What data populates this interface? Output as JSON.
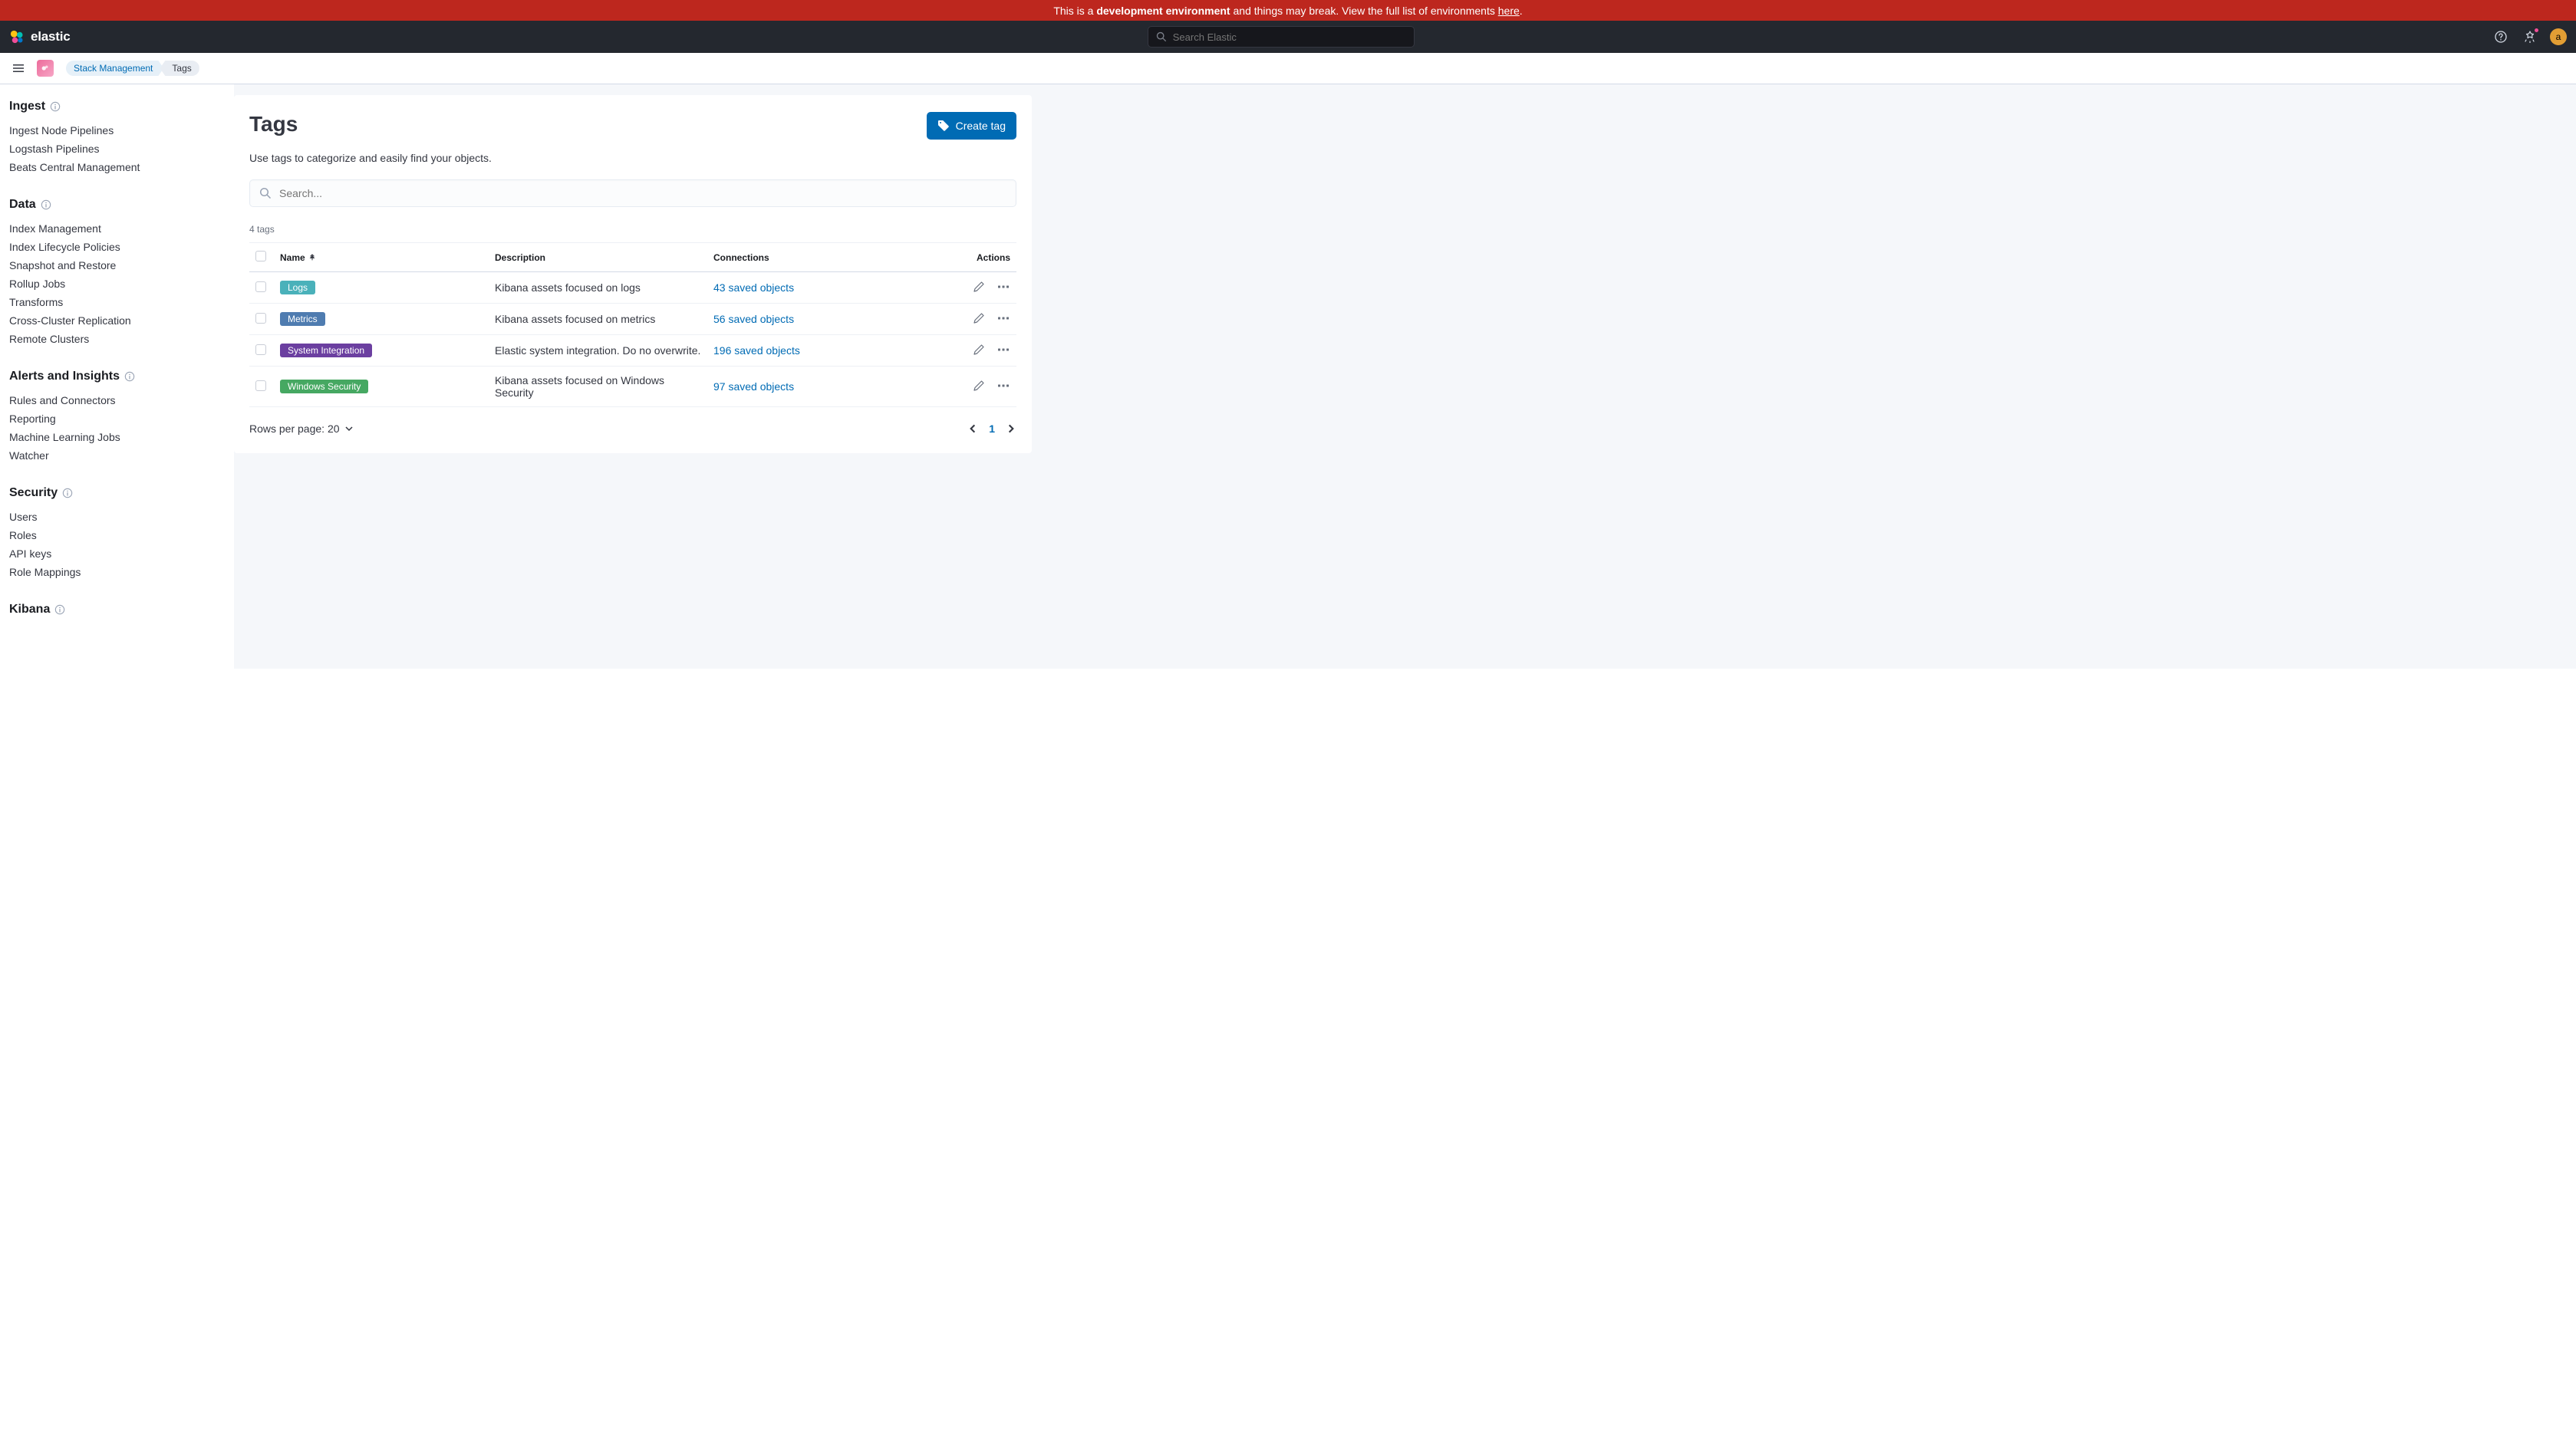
{
  "banner": {
    "prefix": "This is a ",
    "strong": "development environment",
    "mid": " and things may break. View the full list of environments ",
    "link": "here",
    "suffix": "."
  },
  "header": {
    "wordmark": "elastic",
    "search_placeholder": "Search Elastic",
    "avatar_initial": "a"
  },
  "breadcrumbs": {
    "items": [
      {
        "label": "Stack Management",
        "link": true
      },
      {
        "label": "Tags",
        "link": false
      }
    ]
  },
  "sidenav": {
    "sections": [
      {
        "heading": "Ingest",
        "items": [
          "Ingest Node Pipelines",
          "Logstash Pipelines",
          "Beats Central Management"
        ]
      },
      {
        "heading": "Data",
        "items": [
          "Index Management",
          "Index Lifecycle Policies",
          "Snapshot and Restore",
          "Rollup Jobs",
          "Transforms",
          "Cross-Cluster Replication",
          "Remote Clusters"
        ]
      },
      {
        "heading": "Alerts and Insights",
        "items": [
          "Rules and Connectors",
          "Reporting",
          "Machine Learning Jobs",
          "Watcher"
        ]
      },
      {
        "heading": "Security",
        "items": [
          "Users",
          "Roles",
          "API keys",
          "Role Mappings"
        ]
      },
      {
        "heading": "Kibana",
        "items": []
      }
    ]
  },
  "page": {
    "title": "Tags",
    "description": "Use tags to categorize and easily find your objects.",
    "create_label": "Create tag",
    "search_placeholder": "Search...",
    "count_label": "4 tags",
    "columns": {
      "name": "Name",
      "description": "Description",
      "connections": "Connections",
      "actions": "Actions"
    },
    "rows": [
      {
        "tag": "Logs",
        "color": "#4ab1ba",
        "dark": false,
        "description": "Kibana assets focused on logs",
        "connections": "43 saved objects"
      },
      {
        "tag": "Metrics",
        "color": "#4f7cb0",
        "dark": false,
        "description": "Kibana assets focused on metrics",
        "connections": "56 saved objects"
      },
      {
        "tag": "System Integration",
        "color": "#6b3fa0",
        "dark": false,
        "description": "Elastic system integration. Do no overwrite.",
        "connections": "196 saved objects"
      },
      {
        "tag": "Windows Security",
        "color": "#46a862",
        "dark": false,
        "description": "Kibana assets focused on Windows Security",
        "connections": "97 saved objects"
      }
    ],
    "rows_per_page_label": "Rows per page: 20",
    "current_page": "1"
  }
}
